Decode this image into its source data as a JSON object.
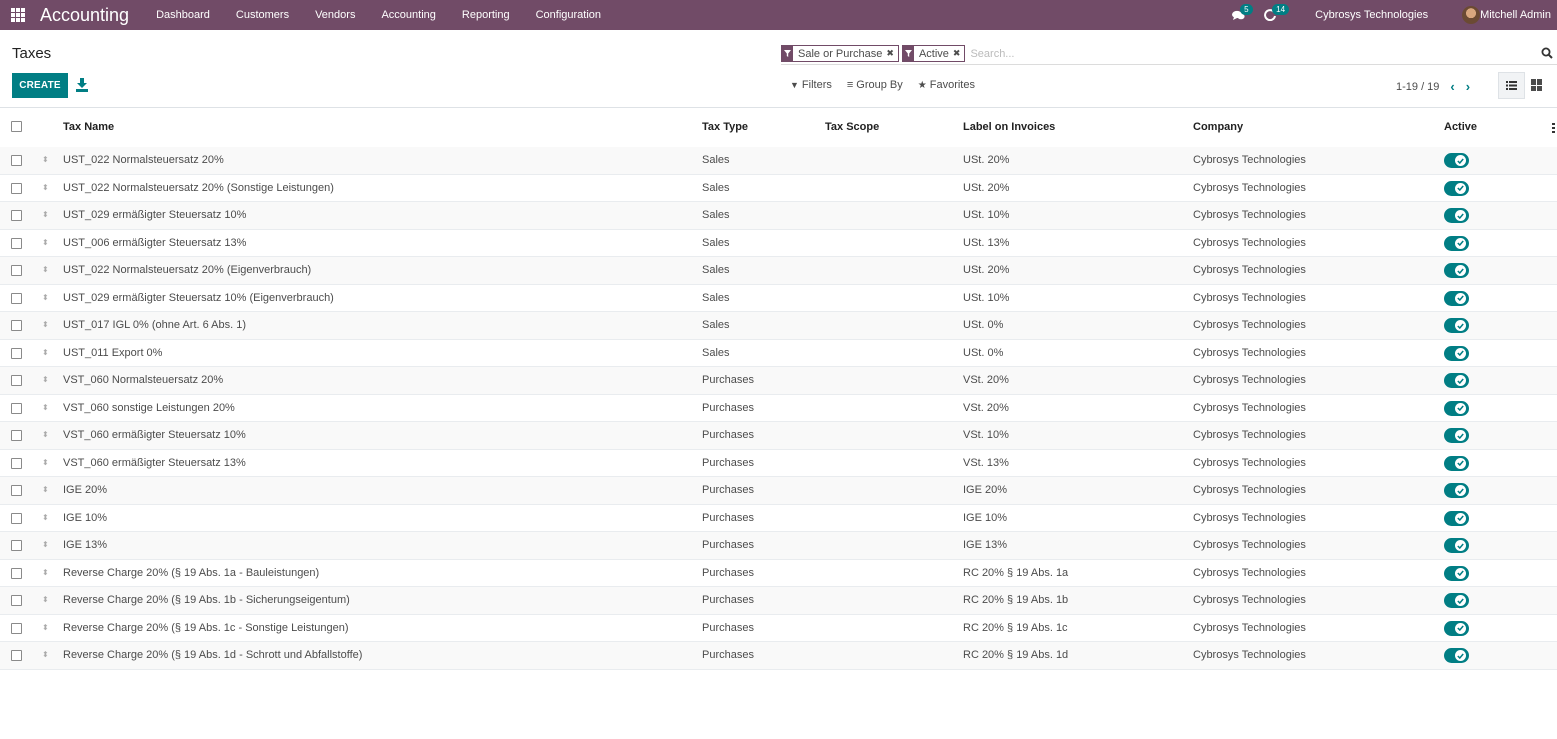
{
  "navbar": {
    "app_name": "Accounting",
    "menu": [
      "Dashboard",
      "Customers",
      "Vendors",
      "Accounting",
      "Reporting",
      "Configuration"
    ],
    "messages_count": "5",
    "activities_count": "14",
    "company": "Cybrosys Technologies",
    "user": "Mitchell Admin"
  },
  "control_panel": {
    "title": "Taxes",
    "create_label": "CREATE",
    "facets": [
      {
        "label": "Sale or Purchase",
        "remove": "✖"
      },
      {
        "label": "Active",
        "remove": "✖"
      }
    ],
    "search_placeholder": "Search...",
    "filters_label": "Filters",
    "group_by_label": "Group By",
    "favorites_label": "Favorites",
    "pager": "1-19 / 19"
  },
  "colors": {
    "brand": "#714b67",
    "accent": "#017e84"
  },
  "table": {
    "columns": [
      "Tax Name",
      "Tax Type",
      "Tax Scope",
      "Label on Invoices",
      "Company",
      "Active"
    ],
    "rows": [
      {
        "name": "UST_022 Normalsteuersatz 20%",
        "type": "Sales",
        "scope": "",
        "label": "USt. 20%",
        "company": "Cybrosys Technologies",
        "active": true
      },
      {
        "name": "UST_022 Normalsteuersatz 20% (Sonstige Leistungen)",
        "type": "Sales",
        "scope": "",
        "label": "USt. 20%",
        "company": "Cybrosys Technologies",
        "active": true
      },
      {
        "name": "UST_029 ermäßigter Steuersatz 10%",
        "type": "Sales",
        "scope": "",
        "label": "USt. 10%",
        "company": "Cybrosys Technologies",
        "active": true
      },
      {
        "name": "UST_006 ermäßigter Steuersatz 13%",
        "type": "Sales",
        "scope": "",
        "label": "USt. 13%",
        "company": "Cybrosys Technologies",
        "active": true
      },
      {
        "name": "UST_022 Normalsteuersatz 20% (Eigenverbrauch)",
        "type": "Sales",
        "scope": "",
        "label": "USt. 20%",
        "company": "Cybrosys Technologies",
        "active": true
      },
      {
        "name": "UST_029 ermäßigter Steuersatz 10% (Eigenverbrauch)",
        "type": "Sales",
        "scope": "",
        "label": "USt. 10%",
        "company": "Cybrosys Technologies",
        "active": true
      },
      {
        "name": "UST_017 IGL 0% (ohne Art. 6 Abs. 1)",
        "type": "Sales",
        "scope": "",
        "label": "USt. 0%",
        "company": "Cybrosys Technologies",
        "active": true
      },
      {
        "name": "UST_011 Export 0%",
        "type": "Sales",
        "scope": "",
        "label": "USt. 0%",
        "company": "Cybrosys Technologies",
        "active": true
      },
      {
        "name": "VST_060 Normalsteuersatz 20%",
        "type": "Purchases",
        "scope": "",
        "label": "VSt. 20%",
        "company": "Cybrosys Technologies",
        "active": true
      },
      {
        "name": "VST_060 sonstige Leistungen 20%",
        "type": "Purchases",
        "scope": "",
        "label": "VSt. 20%",
        "company": "Cybrosys Technologies",
        "active": true
      },
      {
        "name": "VST_060 ermäßigter Steuersatz 10%",
        "type": "Purchases",
        "scope": "",
        "label": "VSt. 10%",
        "company": "Cybrosys Technologies",
        "active": true
      },
      {
        "name": "VST_060 ermäßigter Steuersatz 13%",
        "type": "Purchases",
        "scope": "",
        "label": "VSt. 13%",
        "company": "Cybrosys Technologies",
        "active": true
      },
      {
        "name": "IGE 20%",
        "type": "Purchases",
        "scope": "",
        "label": "IGE 20%",
        "company": "Cybrosys Technologies",
        "active": true
      },
      {
        "name": "IGE 10%",
        "type": "Purchases",
        "scope": "",
        "label": "IGE 10%",
        "company": "Cybrosys Technologies",
        "active": true
      },
      {
        "name": "IGE 13%",
        "type": "Purchases",
        "scope": "",
        "label": "IGE 13%",
        "company": "Cybrosys Technologies",
        "active": true
      },
      {
        "name": "Reverse Charge 20% (§ 19 Abs. 1a - Bauleistungen)",
        "type": "Purchases",
        "scope": "",
        "label": "RC 20% § 19 Abs. 1a",
        "company": "Cybrosys Technologies",
        "active": true
      },
      {
        "name": "Reverse Charge 20% (§ 19 Abs. 1b - Sicherungseigentum)",
        "type": "Purchases",
        "scope": "",
        "label": "RC 20% § 19 Abs. 1b",
        "company": "Cybrosys Technologies",
        "active": true
      },
      {
        "name": "Reverse Charge 20% (§ 19 Abs. 1c - Sonstige Leistungen)",
        "type": "Purchases",
        "scope": "",
        "label": "RC 20% § 19 Abs. 1c",
        "company": "Cybrosys Technologies",
        "active": true
      },
      {
        "name": "Reverse Charge 20% (§ 19 Abs. 1d - Schrott und Abfallstoffe)",
        "type": "Purchases",
        "scope": "",
        "label": "RC 20% § 19 Abs. 1d",
        "company": "Cybrosys Technologies",
        "active": true
      }
    ]
  }
}
